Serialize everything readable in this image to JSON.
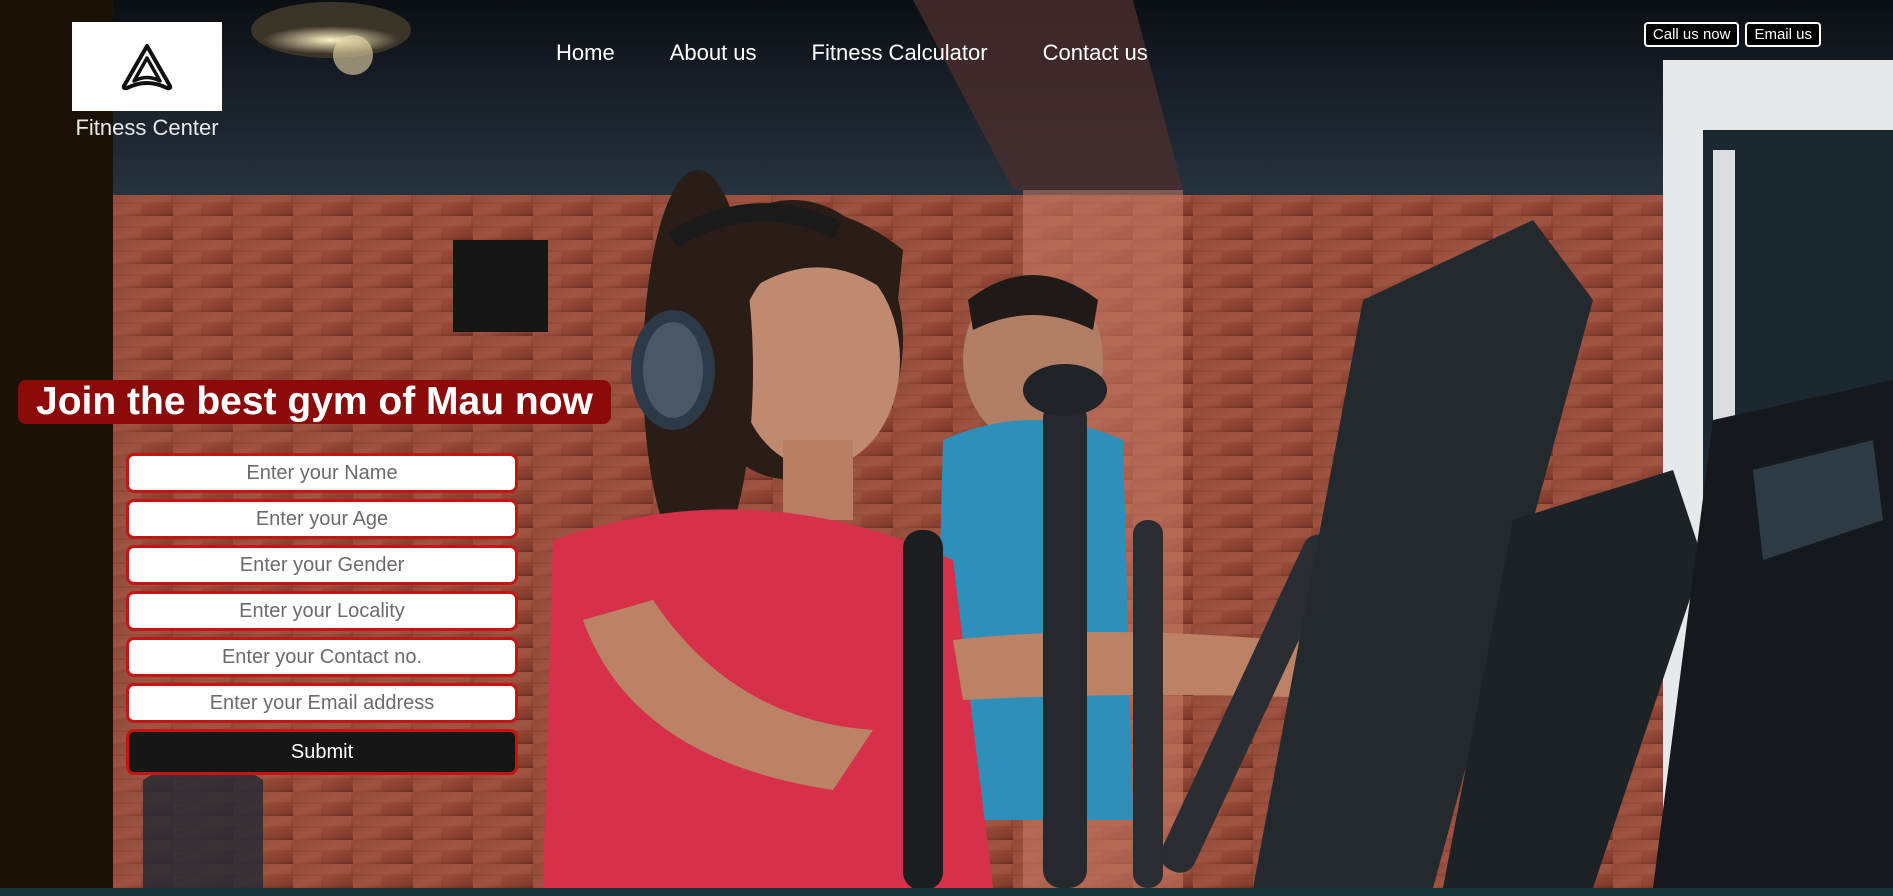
{
  "brand": {
    "name": "Fitness Center",
    "logo_icon": "triangle-loop-logo"
  },
  "nav": {
    "items": [
      {
        "label": "Home"
      },
      {
        "label": "About us"
      },
      {
        "label": "Fitness Calculator"
      },
      {
        "label": "Contact us"
      }
    ]
  },
  "top_actions": {
    "call_label": "Call us now",
    "email_label": "Email us"
  },
  "hero": {
    "headline": "Join the best gym of Mau now"
  },
  "form": {
    "name_placeholder": "Enter your Name",
    "age_placeholder": "Enter your Age",
    "gender_placeholder": "Enter your Gender",
    "locality_placeholder": "Enter your Locality",
    "contact_placeholder": "Enter your Contact no.",
    "email_placeholder": "Enter your Email address",
    "submit_label": "Submit"
  },
  "colors": {
    "accent_red": "#c41515",
    "headline_bg": "#8b0b0b",
    "submit_bg": "#161616"
  }
}
